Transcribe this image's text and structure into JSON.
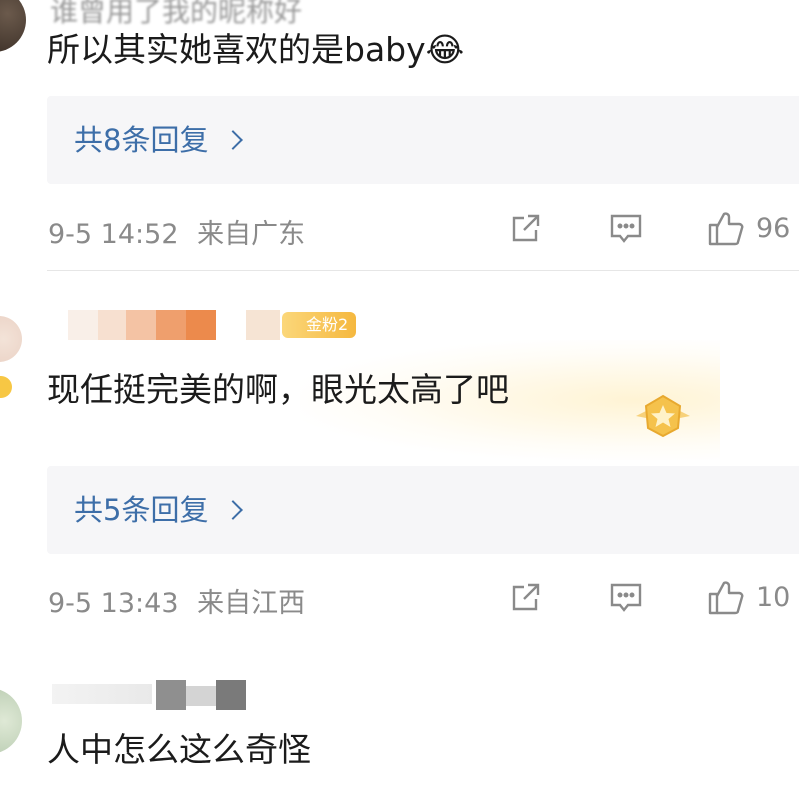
{
  "comments": [
    {
      "text": "所以其实她喜欢的是baby😂",
      "username_fragment": "谁曾用了我的昵称好",
      "replies_label": "共8条回复",
      "timestamp": "9-5 14:52",
      "location": "来自广东",
      "likes": "96"
    },
    {
      "text": "现任挺完美的啊，眼光太高了吧",
      "badge": "金粉2",
      "replies_label": "共5条回复",
      "timestamp": "9-5 13:43",
      "location": "来自江西",
      "likes": "10"
    },
    {
      "text": "人中怎么这么奇怪"
    }
  ],
  "icons": {
    "share": "share-icon",
    "comment": "comment-icon",
    "like": "thumbs-up-icon"
  },
  "colors": {
    "link": "#3d6ea8",
    "meta": "#8a8a8a",
    "reply_bg": "#f6f6f8",
    "badge": "#f5b83f"
  }
}
